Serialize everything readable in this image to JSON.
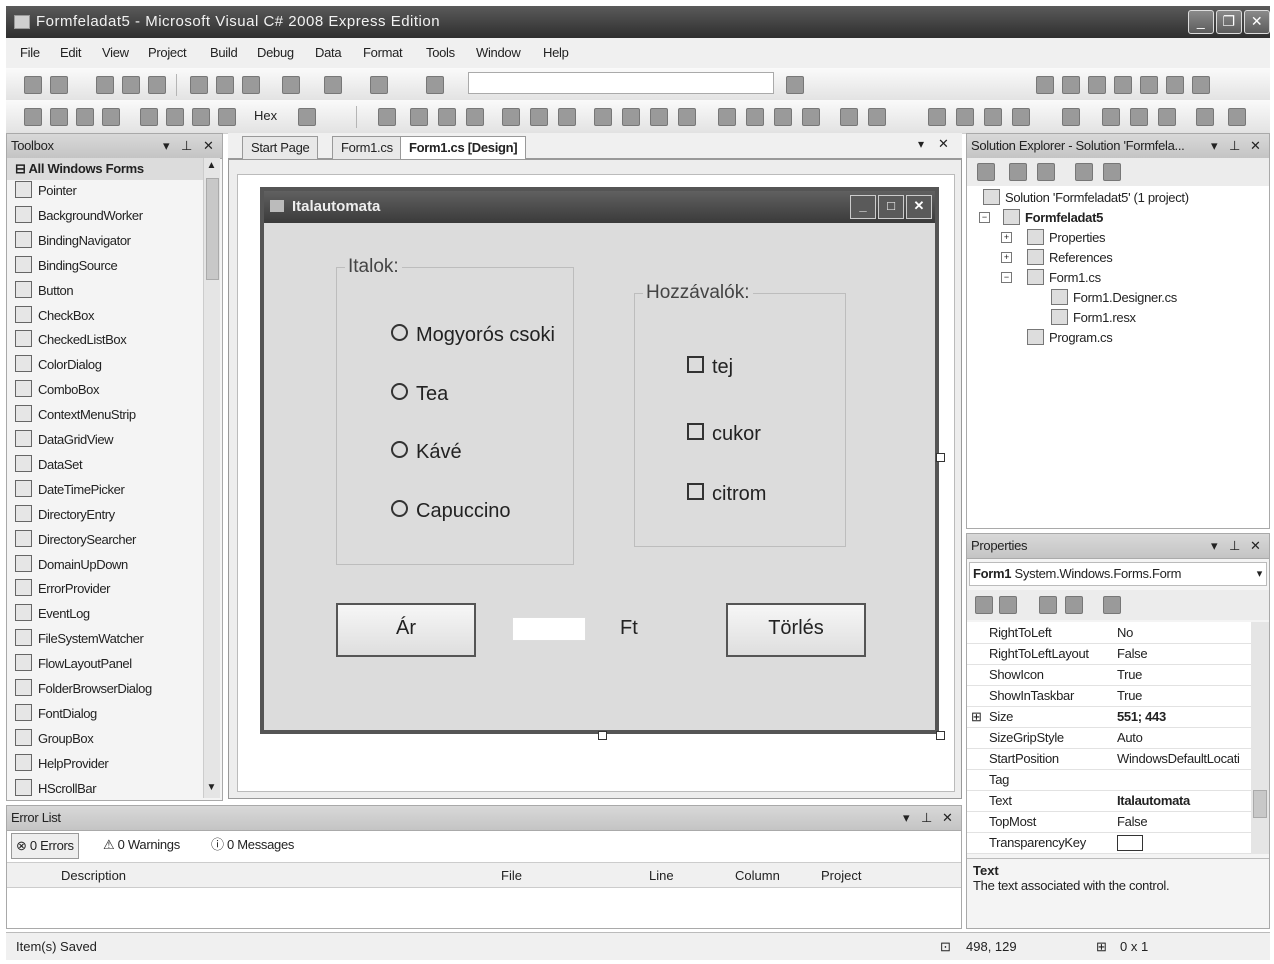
{
  "window": {
    "title": "Formfeladat5 - Microsoft Visual C# 2008 Express Edition"
  },
  "menu": [
    "File",
    "Edit",
    "View",
    "Project",
    "Build",
    "Debug",
    "Data",
    "Format",
    "Tools",
    "Window",
    "Help"
  ],
  "toolbar2": {
    "hex_label": "Hex"
  },
  "toolbox": {
    "title": "Toolbox",
    "section": "All Windows Forms",
    "items": [
      "Pointer",
      "BackgroundWorker",
      "BindingNavigator",
      "BindingSource",
      "Button",
      "CheckBox",
      "CheckedListBox",
      "ColorDialog",
      "ComboBox",
      "ContextMenuStrip",
      "DataGridView",
      "DataSet",
      "DateTimePicker",
      "DirectoryEntry",
      "DirectorySearcher",
      "DomainUpDown",
      "ErrorProvider",
      "EventLog",
      "FileSystemWatcher",
      "FlowLayoutPanel",
      "FolderBrowserDialog",
      "FontDialog",
      "GroupBox",
      "HelpProvider",
      "HScrollBar"
    ]
  },
  "editor": {
    "tabs": [
      "Start Page",
      "Form1.cs",
      "Form1.cs [Design]"
    ]
  },
  "form": {
    "title": "Italautomata",
    "group_drinks": "Italok:",
    "radios": [
      "Mogyorós csoki",
      "Tea",
      "Kávé",
      "Capuccino"
    ],
    "group_extras": "Hozzávalók:",
    "checks": [
      "tej",
      "cukor",
      "citrom"
    ],
    "price_button": "Ár",
    "currency": "Ft",
    "clear_button": "Törlés"
  },
  "solution": {
    "title": "Solution Explorer - Solution 'Formfela...",
    "solution_node": "Solution 'Formfeladat5' (1 project)",
    "project_node": "Formfeladat5",
    "properties_node": "Properties",
    "references_node": "References",
    "form1_node": "Form1.cs",
    "designer_node": "Form1.Designer.cs",
    "resx_node": "Form1.resx",
    "program_node": "Program.cs"
  },
  "properties": {
    "title": "Properties",
    "object_name": "Form1",
    "object_type": "System.Windows.Forms.Form",
    "rows": [
      {
        "name": "RightToLeft",
        "value": "No"
      },
      {
        "name": "RightToLeftLayout",
        "value": "False"
      },
      {
        "name": "ShowIcon",
        "value": "True"
      },
      {
        "name": "ShowInTaskbar",
        "value": "True"
      },
      {
        "name": "Size",
        "value": "551; 443"
      },
      {
        "name": "SizeGripStyle",
        "value": "Auto"
      },
      {
        "name": "StartPosition",
        "value": "WindowsDefaultLocati"
      },
      {
        "name": "Tag",
        "value": ""
      },
      {
        "name": "Text",
        "value": "Italautomata"
      },
      {
        "name": "TopMost",
        "value": "False"
      },
      {
        "name": "TransparencyKey",
        "value": ""
      }
    ],
    "desc_title": "Text",
    "desc_text": "The text associated with the control."
  },
  "errors": {
    "title": "Error List",
    "errors_tab": "0 Errors",
    "warnings_tab": "0 Warnings",
    "messages_tab": "0 Messages",
    "columns": [
      "Description",
      "File",
      "Line",
      "Column",
      "Project"
    ]
  },
  "status": {
    "text": "Item(s) Saved",
    "position": "498, 129",
    "size": "0 x 1"
  }
}
